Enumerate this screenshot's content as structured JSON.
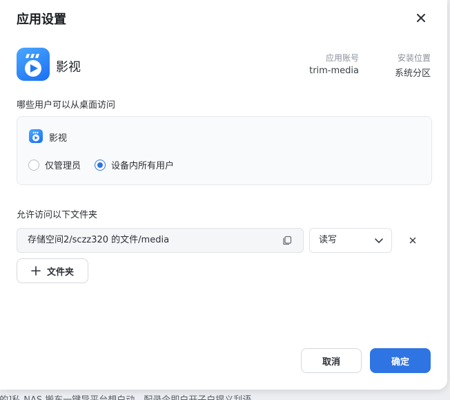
{
  "dialog": {
    "title": "应用设置",
    "app": {
      "name": "影视",
      "account_label": "应用账号",
      "account_value": "trim-media",
      "location_label": "安装位置",
      "location_value": "系统分区"
    },
    "access": {
      "label": "哪些用户可以从桌面访问",
      "app_name": "影视",
      "options": [
        {
          "label": "仅管理员",
          "checked": false
        },
        {
          "label": "设备内所有用户",
          "checked": true
        }
      ]
    },
    "folders": {
      "label": "允许访问以下文件夹",
      "items": [
        {
          "path": "存储空间2/sczz320 的文件/media",
          "permission": "读写"
        }
      ],
      "add_label": "文件夹"
    },
    "buttons": {
      "cancel": "取消",
      "ok": "确定"
    }
  },
  "background": {
    "partial_text": "[的]私 NAS 搬东一键导平台想白动，配录今即白开子白提义刮语"
  },
  "colors": {
    "accent": "#2f74e3",
    "app_icon_top": "#4aa8ff",
    "app_icon_bottom": "#1a6ff2"
  },
  "icons": {
    "close": "close-icon",
    "copy": "copy-icon",
    "chevron": "chevron-down-icon",
    "remove": "remove-icon",
    "add": "plus-icon",
    "app": "media-app-icon"
  }
}
